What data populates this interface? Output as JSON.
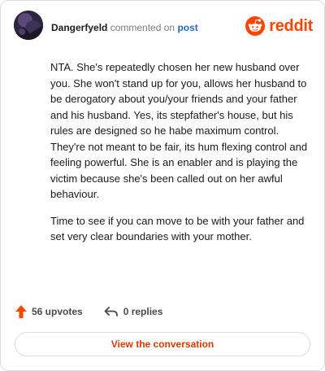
{
  "header": {
    "username": "Dangerfyeld",
    "action_text": "commented on",
    "post_link": "post",
    "brand_text": "reddit"
  },
  "comment": {
    "paragraphs": [
      "NTA. She's repeatedly chosen her new husband over you. She won't stand up for you, allows her husband to be derogatory about you/your friends and your father and his husband. Yes, its stepfather's house, but his rules are designed so he habe maximum control. They're not meant to be fair, its hum flexing control and feeling powerful. She is an enabler and is playing the victim because she's been called out on her awful behaviour.",
      "Time to see if you can move to be with your father and set very clear boundaries with your mother."
    ]
  },
  "actions": {
    "upvotes": "56 upvotes",
    "replies": "0 replies"
  },
  "cta": {
    "label": "View the conversation"
  },
  "colors": {
    "brand": "#ff4500",
    "link": "#2469c2",
    "cta_text": "#d93900"
  },
  "icons": {
    "avatar": "avatar",
    "logo": "reddit-snoo-icon",
    "upvote": "upvote-arrow-icon",
    "reply": "reply-arrow-icon"
  }
}
